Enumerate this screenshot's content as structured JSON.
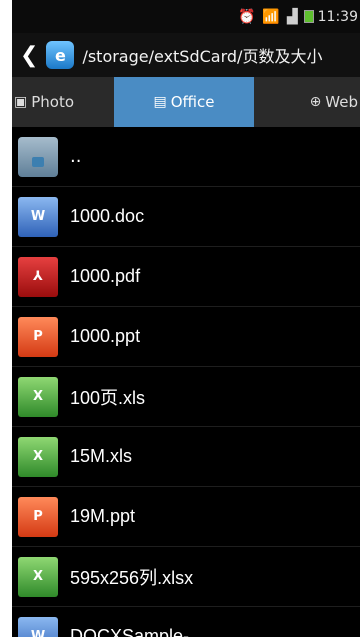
{
  "status_bar": {
    "alarm_icon": "alarm-clock-icon",
    "wifi_icon": "wifi-icon",
    "signal_icon": "signal-icon",
    "battery_icon": "battery-icon",
    "time": "11:39"
  },
  "header": {
    "back_icon": "back-chevron-icon",
    "app_icon": "file-manager-icon",
    "path": "/storage/extSdCard/页数及大小"
  },
  "tabs": [
    {
      "label": "Photo",
      "icon": "image-icon",
      "selected": false
    },
    {
      "label": "Office",
      "icon": "document-icon",
      "selected": true
    },
    {
      "label": "Web",
      "icon": "globe-icon",
      "selected": false
    }
  ],
  "files": [
    {
      "name": "..",
      "type": "folder-up"
    },
    {
      "name": "1000.doc",
      "type": "doc"
    },
    {
      "name": "1000.pdf",
      "type": "pdf"
    },
    {
      "name": "1000.ppt",
      "type": "ppt"
    },
    {
      "name": "100页.xls",
      "type": "xls"
    },
    {
      "name": "15M.xls",
      "type": "xls"
    },
    {
      "name": "19M.ppt",
      "type": "ppt"
    },
    {
      "name": "595x256列.xlsx",
      "type": "xls"
    },
    {
      "name": "DOCXSample-",
      "type": "doc"
    }
  ],
  "colors": {
    "tab_selected": "#4a8cc4",
    "background": "#000000"
  }
}
